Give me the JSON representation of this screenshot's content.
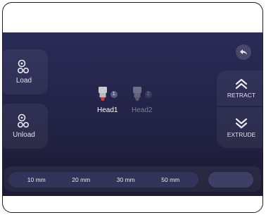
{
  "actions": {
    "load_label": "Load",
    "unload_label": "Unload",
    "retract_label": "RETRACT",
    "extrude_label": "EXTRUDE"
  },
  "heads": [
    {
      "name": "Head1",
      "number": "1",
      "active": true
    },
    {
      "name": "Head2",
      "number": "2",
      "active": false
    }
  ],
  "distances": [
    "10 mm",
    "20 mm",
    "30 mm",
    "50 mm"
  ],
  "icons": {
    "back": "back-arrow-icon",
    "filament": "filament-spool-icon",
    "up": "chevron-double-up-icon",
    "down": "chevron-double-down-icon",
    "nozzle": "nozzle-icon"
  },
  "colors": {
    "nozzle_tip": "#d23a3a",
    "active_text": "#ffffff",
    "inactive_text": "#7d7e99"
  }
}
